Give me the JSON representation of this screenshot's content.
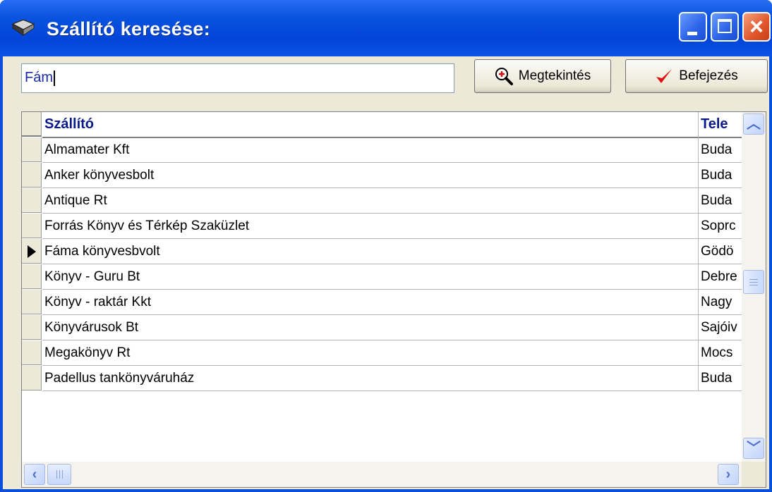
{
  "window": {
    "title": "Szállító keresése:",
    "icon": "book-icon",
    "controls": {
      "minimize": "minimize-icon",
      "maximize": "maximize-icon",
      "close": "close-icon"
    }
  },
  "search": {
    "value": "Fám"
  },
  "buttons": {
    "view": {
      "label": "Megtekintés",
      "icon": "zoom-in-icon"
    },
    "finish": {
      "label": "Befejezés",
      "icon": "checkmark-icon",
      "icon_color": "#e01010"
    }
  },
  "grid": {
    "columns": [
      "Szállító",
      "Tele"
    ],
    "rows": [
      {
        "name": "Almamater Kft",
        "city": "Buda",
        "current": false
      },
      {
        "name": "Anker könyvesbolt",
        "city": "Buda",
        "current": false
      },
      {
        "name": "Antique Rt",
        "city": "Buda",
        "current": false
      },
      {
        "name": "Forrás Könyv és Térkép Szaküzlet",
        "city": "Soprc",
        "current": false
      },
      {
        "name": "Fáma könyvesbvolt",
        "city": "Gödö",
        "current": true
      },
      {
        "name": "Könyv - Guru Bt",
        "city": "Debre",
        "current": false
      },
      {
        "name": "Könyv - raktár Kkt",
        "city": "Nagy",
        "current": false
      },
      {
        "name": "Könyvárusok Bt",
        "city": "Sajóiv",
        "current": false
      },
      {
        "name": "Megakönyv Rt",
        "city": "Mocs",
        "current": false
      },
      {
        "name": "Padellus tankönyváruház",
        "city": "Buda",
        "current": false
      }
    ]
  },
  "colors": {
    "titlebar": "#0a53e0",
    "header_text": "#0a1a8a",
    "face": "#ece9d8"
  }
}
